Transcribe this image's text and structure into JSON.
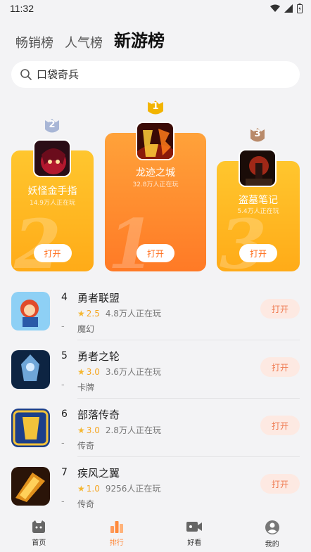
{
  "status_bar": {
    "time": "11:32"
  },
  "tabs": [
    {
      "label": "畅销榜"
    },
    {
      "label": "人气榜"
    },
    {
      "label": "新游榜"
    }
  ],
  "search": {
    "placeholder": "口袋奇兵"
  },
  "podium": {
    "first": {
      "rank": "1",
      "name": "龙迹之城",
      "players": "32.8万人正在玩",
      "open_label": "打开",
      "bignum": "1"
    },
    "second": {
      "rank": "2",
      "name": "妖怪金手指",
      "players": "14.9万人正在玩",
      "open_label": "打开",
      "bignum": "2"
    },
    "third": {
      "rank": "3",
      "name": "盗墓笔记",
      "players": "5.4万人正在玩",
      "open_label": "打开",
      "bignum": "3"
    }
  },
  "list": [
    {
      "rank": "4",
      "dash": "-",
      "title": "勇者联盟",
      "rating": "2.5",
      "players": "4.8万人正在玩",
      "category": "魔幻",
      "open_label": "打开"
    },
    {
      "rank": "5",
      "dash": "-",
      "title": "勇者之轮",
      "rating": "3.0",
      "players": "3.6万人正在玩",
      "category": "卡牌",
      "open_label": "打开"
    },
    {
      "rank": "6",
      "dash": "-",
      "title": "部落传奇",
      "rating": "3.0",
      "players": "2.8万人正在玩",
      "category": "传奇",
      "open_label": "打开"
    },
    {
      "rank": "7",
      "dash": "-",
      "title": "疾风之翼",
      "rating": "1.0",
      "players": "9256人正在玩",
      "category": "传奇",
      "open_label": "打开"
    }
  ],
  "bottom_nav": [
    {
      "label": "首页",
      "icon": "home-icon"
    },
    {
      "label": "排行",
      "icon": "ranking-icon"
    },
    {
      "label": "好看",
      "icon": "video-icon"
    },
    {
      "label": "我的",
      "icon": "profile-icon"
    }
  ],
  "colors": {
    "accent": "#ff8a3c",
    "card_gold": "#ffb41f",
    "card_orange": "#ff7a26",
    "open_pill": "#fde9e2",
    "star": "#f5a623"
  }
}
